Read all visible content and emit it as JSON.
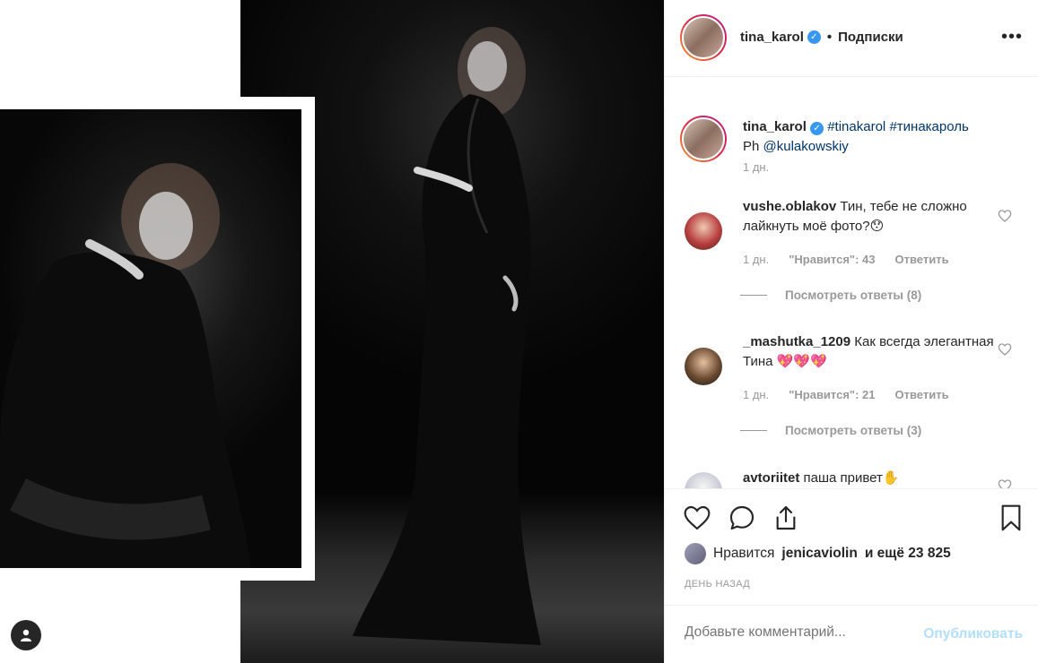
{
  "post": {
    "author": "tina_karol",
    "follow_label": "Подписки",
    "dot": "•",
    "verified_glyph": "✓",
    "more_glyph": "•••"
  },
  "caption": {
    "author": "tina_karol",
    "hashtag1": "#tinakarol",
    "hashtag2": "#тинакароль",
    "ph_prefix": "Ph",
    "mention": "@kulakowskiy",
    "time": "1 дн."
  },
  "comments": [
    {
      "user": "vushe.oblakov",
      "text": "Тин, тебе не сложно лайкнуть моё фото?😯",
      "time": "1 дн.",
      "likes": "\"Нравится\": 43",
      "reply": "Ответить",
      "view_replies": "Посмотреть ответы (8)"
    },
    {
      "user": "_mashutka_1209",
      "text": "Как всегда элегантная Тина 💖💖💖",
      "time": "1 дн.",
      "likes": "\"Нравится\": 21",
      "reply": "Ответить",
      "view_replies": "Посмотреть ответы (3)"
    },
    {
      "user": "avtoriitet",
      "text": "паша привет✋"
    }
  ],
  "likes": {
    "prefix": "Нравится",
    "user": "jenicaviolin",
    "suffix": "и ещё 23 825"
  },
  "timestamp": "ДЕНЬ НАЗАД",
  "add_comment": {
    "placeholder": "Добавьте комментарий...",
    "publish": "Опубликовать"
  },
  "colors": {
    "link": "#003569",
    "muted": "#999999",
    "verified": "#3897f0",
    "publish_disabled": "#b2dffc"
  }
}
